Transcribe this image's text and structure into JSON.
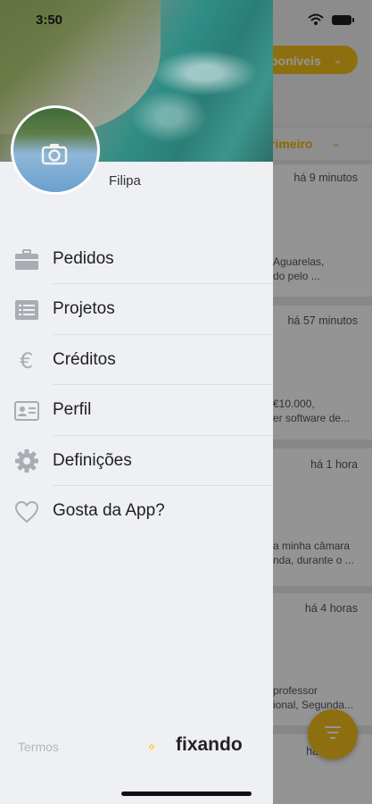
{
  "status_bar": {
    "time": "3:50"
  },
  "background": {
    "filter_pill": "poníveis",
    "sort_label": "rimeiro",
    "cards": [
      {
        "time": "há 9 minutos",
        "lines": [
          "Aguarelas,",
          "do pelo ..."
        ]
      },
      {
        "time": "há 57 minutos",
        "lines": [
          "€10.000,",
          "er software de..."
        ]
      },
      {
        "time": "há 1 hora",
        "lines": [
          "a minha câmara",
          "nda, durante o ..."
        ]
      },
      {
        "time": "há 4 horas",
        "lines": [
          "professor",
          "ional, Segunda..."
        ]
      },
      {
        "time": "há",
        "lines": []
      }
    ]
  },
  "drawer": {
    "user_name": "Filipa",
    "menu": [
      {
        "label": "Pedidos",
        "icon": "briefcase-icon"
      },
      {
        "label": "Projetos",
        "icon": "list-icon"
      },
      {
        "label": "Créditos",
        "icon": "euro-icon"
      },
      {
        "label": "Perfil",
        "icon": "id-card-icon"
      },
      {
        "label": "Definições",
        "icon": "gear-icon"
      },
      {
        "label": "Gosta da App?",
        "icon": "heart-icon"
      }
    ],
    "terms_label": "Termos",
    "brand": "fixando"
  },
  "colors": {
    "accent": "#f5c01a",
    "drawer_bg": "#eef0f3",
    "icon_gray": "#a9acb2"
  }
}
